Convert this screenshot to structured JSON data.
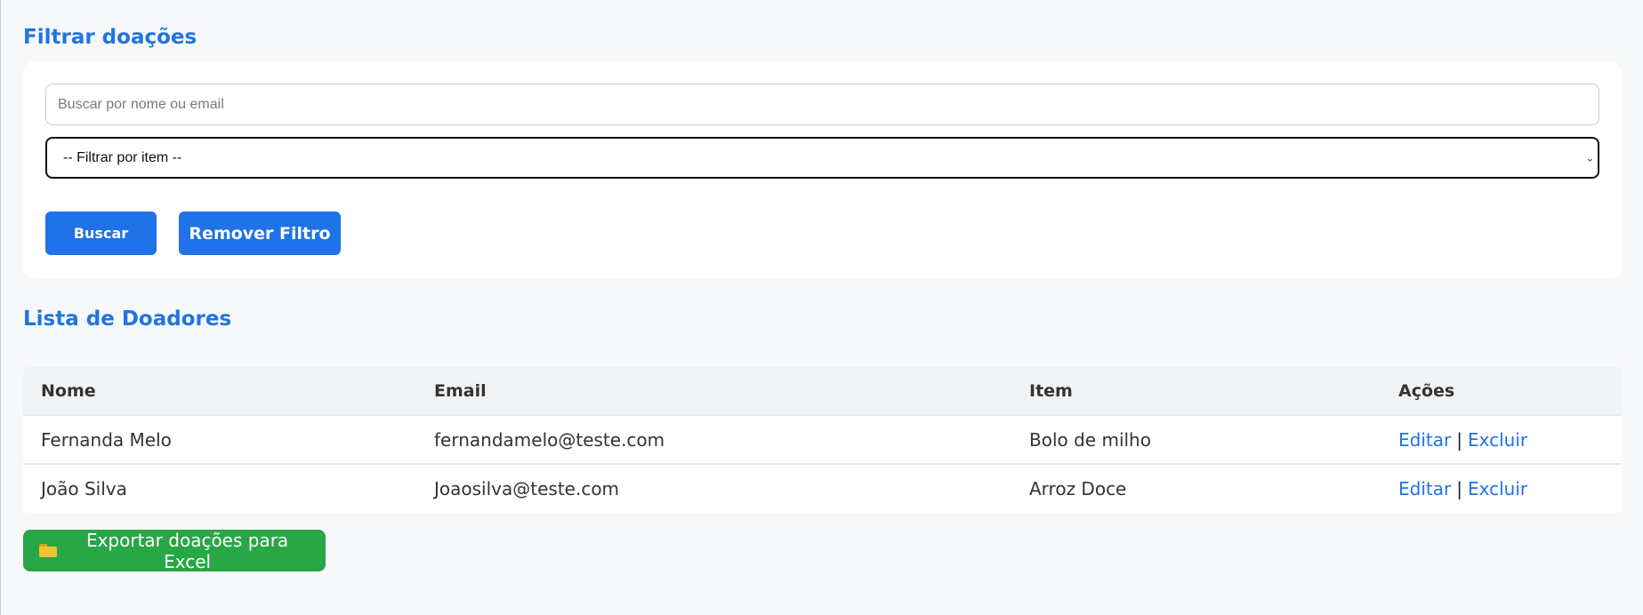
{
  "filter": {
    "title": "Filtrar doações",
    "search_placeholder": "Buscar por nome ou email",
    "select_value": "-- Filtrar por item --",
    "search_button": "Buscar",
    "remove_button": "Remover Filtro"
  },
  "list": {
    "title": "Lista de Doadores",
    "columns": [
      "Nome",
      "Email",
      "Item",
      "Ações"
    ],
    "rows": [
      {
        "nome": "Fernanda Melo",
        "email": "fernandamelo@teste.com",
        "item": "Bolo de milho",
        "edit": "Editar",
        "sep": "|",
        "delete": "Excluir"
      },
      {
        "nome": "João Silva",
        "email": "Joaosilva@teste.com",
        "item": "Arroz Doce",
        "edit": "Editar",
        "sep": "|",
        "delete": "Excluir"
      }
    ]
  },
  "export": {
    "icon": "folder-icon",
    "label": "Exportar doações para Excel"
  },
  "colors": {
    "accent": "#1f75e0",
    "button": "#1f72e8",
    "export": "#27a745"
  }
}
